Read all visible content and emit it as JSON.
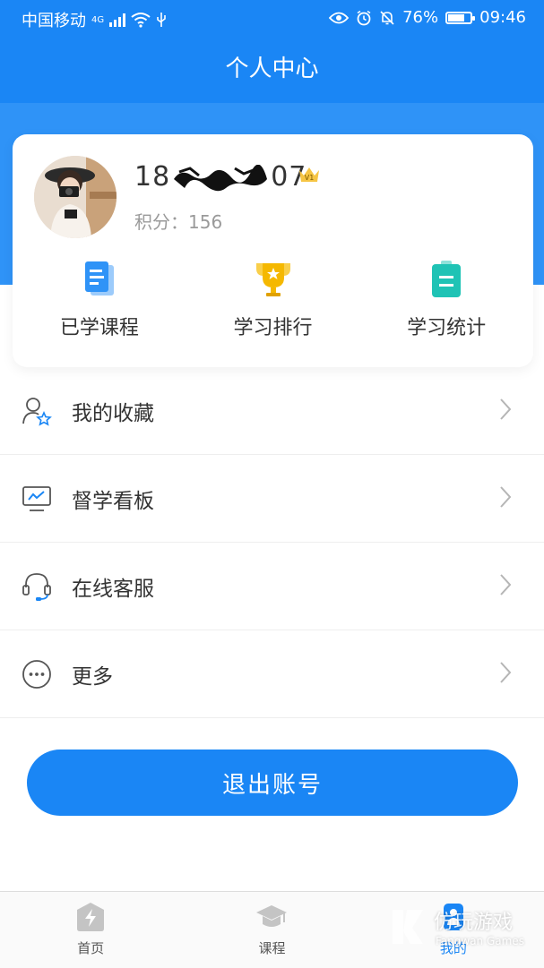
{
  "status_bar": {
    "carrier": "中国移动",
    "network": "4G",
    "battery_percent": "76%",
    "battery_level": 0.76,
    "time": "09:46"
  },
  "header": {
    "title": "个人中心"
  },
  "profile": {
    "phone_prefix": "18",
    "phone_suffix": "07",
    "level_badge": "V1",
    "points_text": "积分：156"
  },
  "quick_actions": [
    {
      "label": "已学课程",
      "icon": "document-icon"
    },
    {
      "label": "学习排行",
      "icon": "trophy-icon"
    },
    {
      "label": "学习统计",
      "icon": "clipboard-icon"
    }
  ],
  "menu": [
    {
      "label": "我的收藏",
      "icon": "user-star-icon"
    },
    {
      "label": "督学看板",
      "icon": "monitor-chart-icon"
    },
    {
      "label": "在线客服",
      "icon": "headset-icon"
    },
    {
      "label": "更多",
      "icon": "more-dots-icon"
    }
  ],
  "logout_label": "退出账号",
  "tabs": [
    {
      "label": "首页",
      "icon": "home-bolt-icon",
      "active": false
    },
    {
      "label": "课程",
      "icon": "graduation-cap-icon",
      "active": false
    },
    {
      "label": "我的",
      "icon": "profile-icon",
      "active": true
    }
  ],
  "watermark": {
    "text": "仿玩游戏",
    "subtext": "Fangwan Games"
  },
  "colors": {
    "primary": "#1a86f5",
    "gold": "#f5b800",
    "teal": "#1fc3b5"
  }
}
